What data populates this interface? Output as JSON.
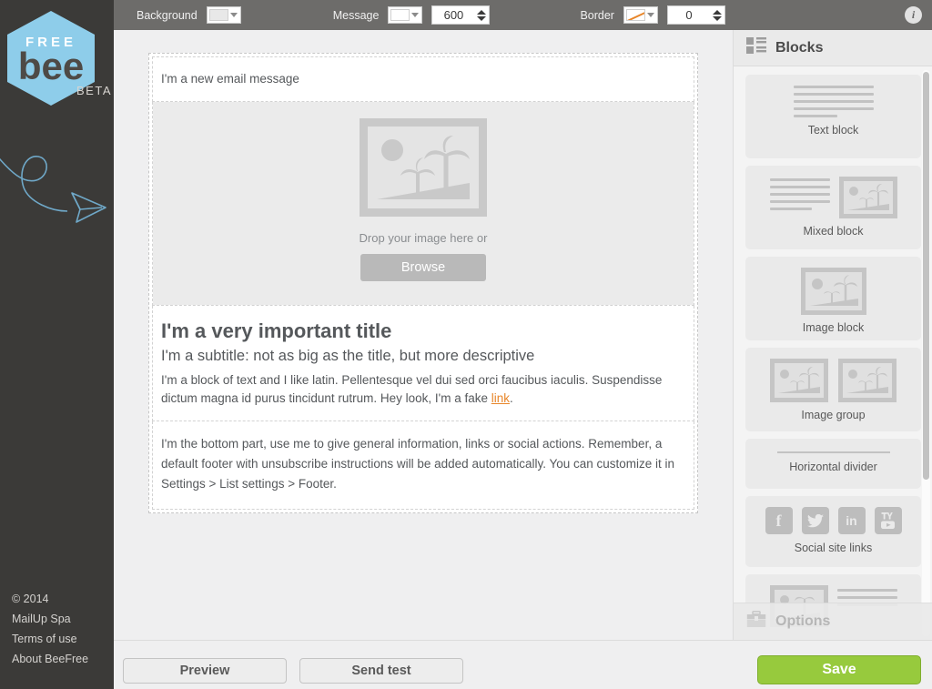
{
  "branding": {
    "logo_free": "FREE",
    "logo_bee": "bee",
    "logo_beta": "BETA",
    "accent_blue": "#8ecdea",
    "sidebar_bg": "#3b3a38"
  },
  "sidebar": {
    "links": [
      {
        "label": "© 2014"
      },
      {
        "label": "MailUp Spa"
      },
      {
        "label": "Terms of use"
      },
      {
        "label": "About BeeFree"
      }
    ]
  },
  "toolbar": {
    "background_label": "Background",
    "background_color": "#e8e8e8",
    "message_label": "Message",
    "message_color": "#ffffff",
    "message_width": "600",
    "border_label": "Border",
    "border_color": "none",
    "border_width": "0",
    "info_glyph": "i"
  },
  "email": {
    "header_text": "I'm a new email message",
    "image_drop_text": "Drop your image here or",
    "browse_label": "Browse",
    "title": "I'm a very important title",
    "subtitle": "I'm a subtitle: not as big as the title, but more descriptive",
    "paragraph_before_link": "I'm a block of text and I like latin. Pellentesque vel dui sed orci faucibus iaculis. Suspendisse dictum magna id purus tincidunt rutrum. Hey look, I'm a fake ",
    "paragraph_link": "link",
    "paragraph_after_link": ".",
    "link_color": "#e8862a",
    "footer_text": "I'm the bottom part, use me to give general information, links or social actions. Remember, a default footer with unsubscribe instructions will be added automatically. You can customize it in Settings > List settings > Footer."
  },
  "blocks_panel": {
    "title": "Blocks",
    "icon": "list-layout-icon",
    "items": [
      {
        "label": "Text block",
        "icon": "text-lines-icon"
      },
      {
        "label": "Mixed block",
        "icon": "text-and-image-icon"
      },
      {
        "label": "Image block",
        "icon": "image-icon"
      },
      {
        "label": "Image group",
        "icon": "two-images-icon"
      },
      {
        "label": "Horizontal divider",
        "icon": "divider-icon"
      },
      {
        "label": "Social site links",
        "icon": "social-icons"
      },
      {
        "label": "",
        "icon": "image-and-text-icon"
      }
    ],
    "social_icons": [
      {
        "name": "facebook-icon",
        "glyph": "f"
      },
      {
        "name": "twitter-icon",
        "glyph": "✈"
      },
      {
        "name": "linkedin-icon",
        "glyph": "in"
      },
      {
        "name": "youtube-icon",
        "glyph": "You"
      }
    ],
    "scroll_thumb_percent": 72
  },
  "options_bar": {
    "title": "Options",
    "icon": "toolbox-icon",
    "disabled": true
  },
  "footer": {
    "preview_label": "Preview",
    "send_test_label": "Send test",
    "save_label": "Save",
    "save_color": "#97ca3d"
  }
}
